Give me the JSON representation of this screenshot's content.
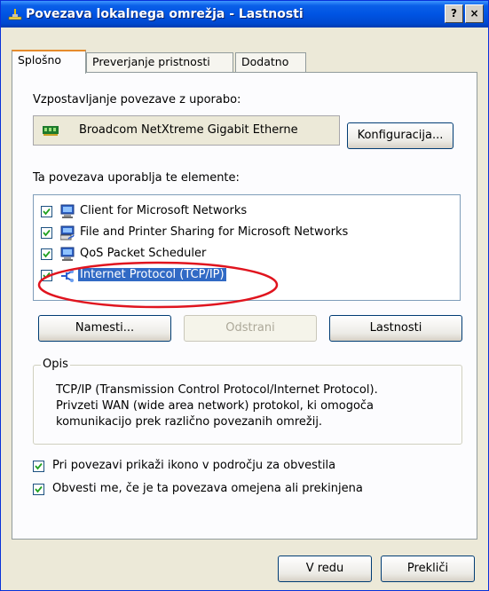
{
  "window": {
    "title": "Povezava lokalnega omrežja - Lastnosti",
    "help_button": "?",
    "close_button": "×"
  },
  "tabs": [
    {
      "label": "Splošno",
      "active": true
    },
    {
      "label": "Preverjanje pristnosti",
      "active": false
    },
    {
      "label": "Dodatno",
      "active": false
    }
  ],
  "connect_using": {
    "label": "Vzpostavljanje povezave z uporabo:",
    "adapter": "Broadcom NetXtreme Gigabit Etherne",
    "configure_button": "Konfiguracija..."
  },
  "components": {
    "label": "Ta povezava uporablja te elemente:",
    "items": [
      {
        "label": "Client for Microsoft Networks",
        "checked": true,
        "icon": "network-client-icon",
        "selected": false
      },
      {
        "label": "File and Printer Sharing for Microsoft Networks",
        "checked": true,
        "icon": "printer-share-icon",
        "selected": false
      },
      {
        "label": "QoS Packet Scheduler",
        "checked": true,
        "icon": "packet-scheduler-icon",
        "selected": false
      },
      {
        "label": "Internet Protocol (TCP/IP)",
        "checked": true,
        "icon": "protocol-icon",
        "selected": true
      }
    ],
    "install_button": "Namesti...",
    "uninstall_button": "Odstrani",
    "properties_button": "Lastnosti"
  },
  "description": {
    "legend": "Opis",
    "lines": [
      "TCP/IP (Transmission Control Protocol/Internet Protocol).",
      "Privzeti WAN (wide area network) protokol, ki omogoča",
      "komunikacijo prek različno povezanih omrežij."
    ]
  },
  "options": [
    {
      "label": "Pri povezavi prikaži ikono v področju za obvestila",
      "checked": true
    },
    {
      "label": "Obvesti me, če je ta povezava omejena ali prekinjena",
      "checked": true
    }
  ],
  "footer": {
    "ok_button": "V redu",
    "cancel_button": "Prekliči"
  },
  "colors": {
    "titlebar": "#0054e3",
    "selection": "#316ac5",
    "annotation": "#e0141e"
  }
}
